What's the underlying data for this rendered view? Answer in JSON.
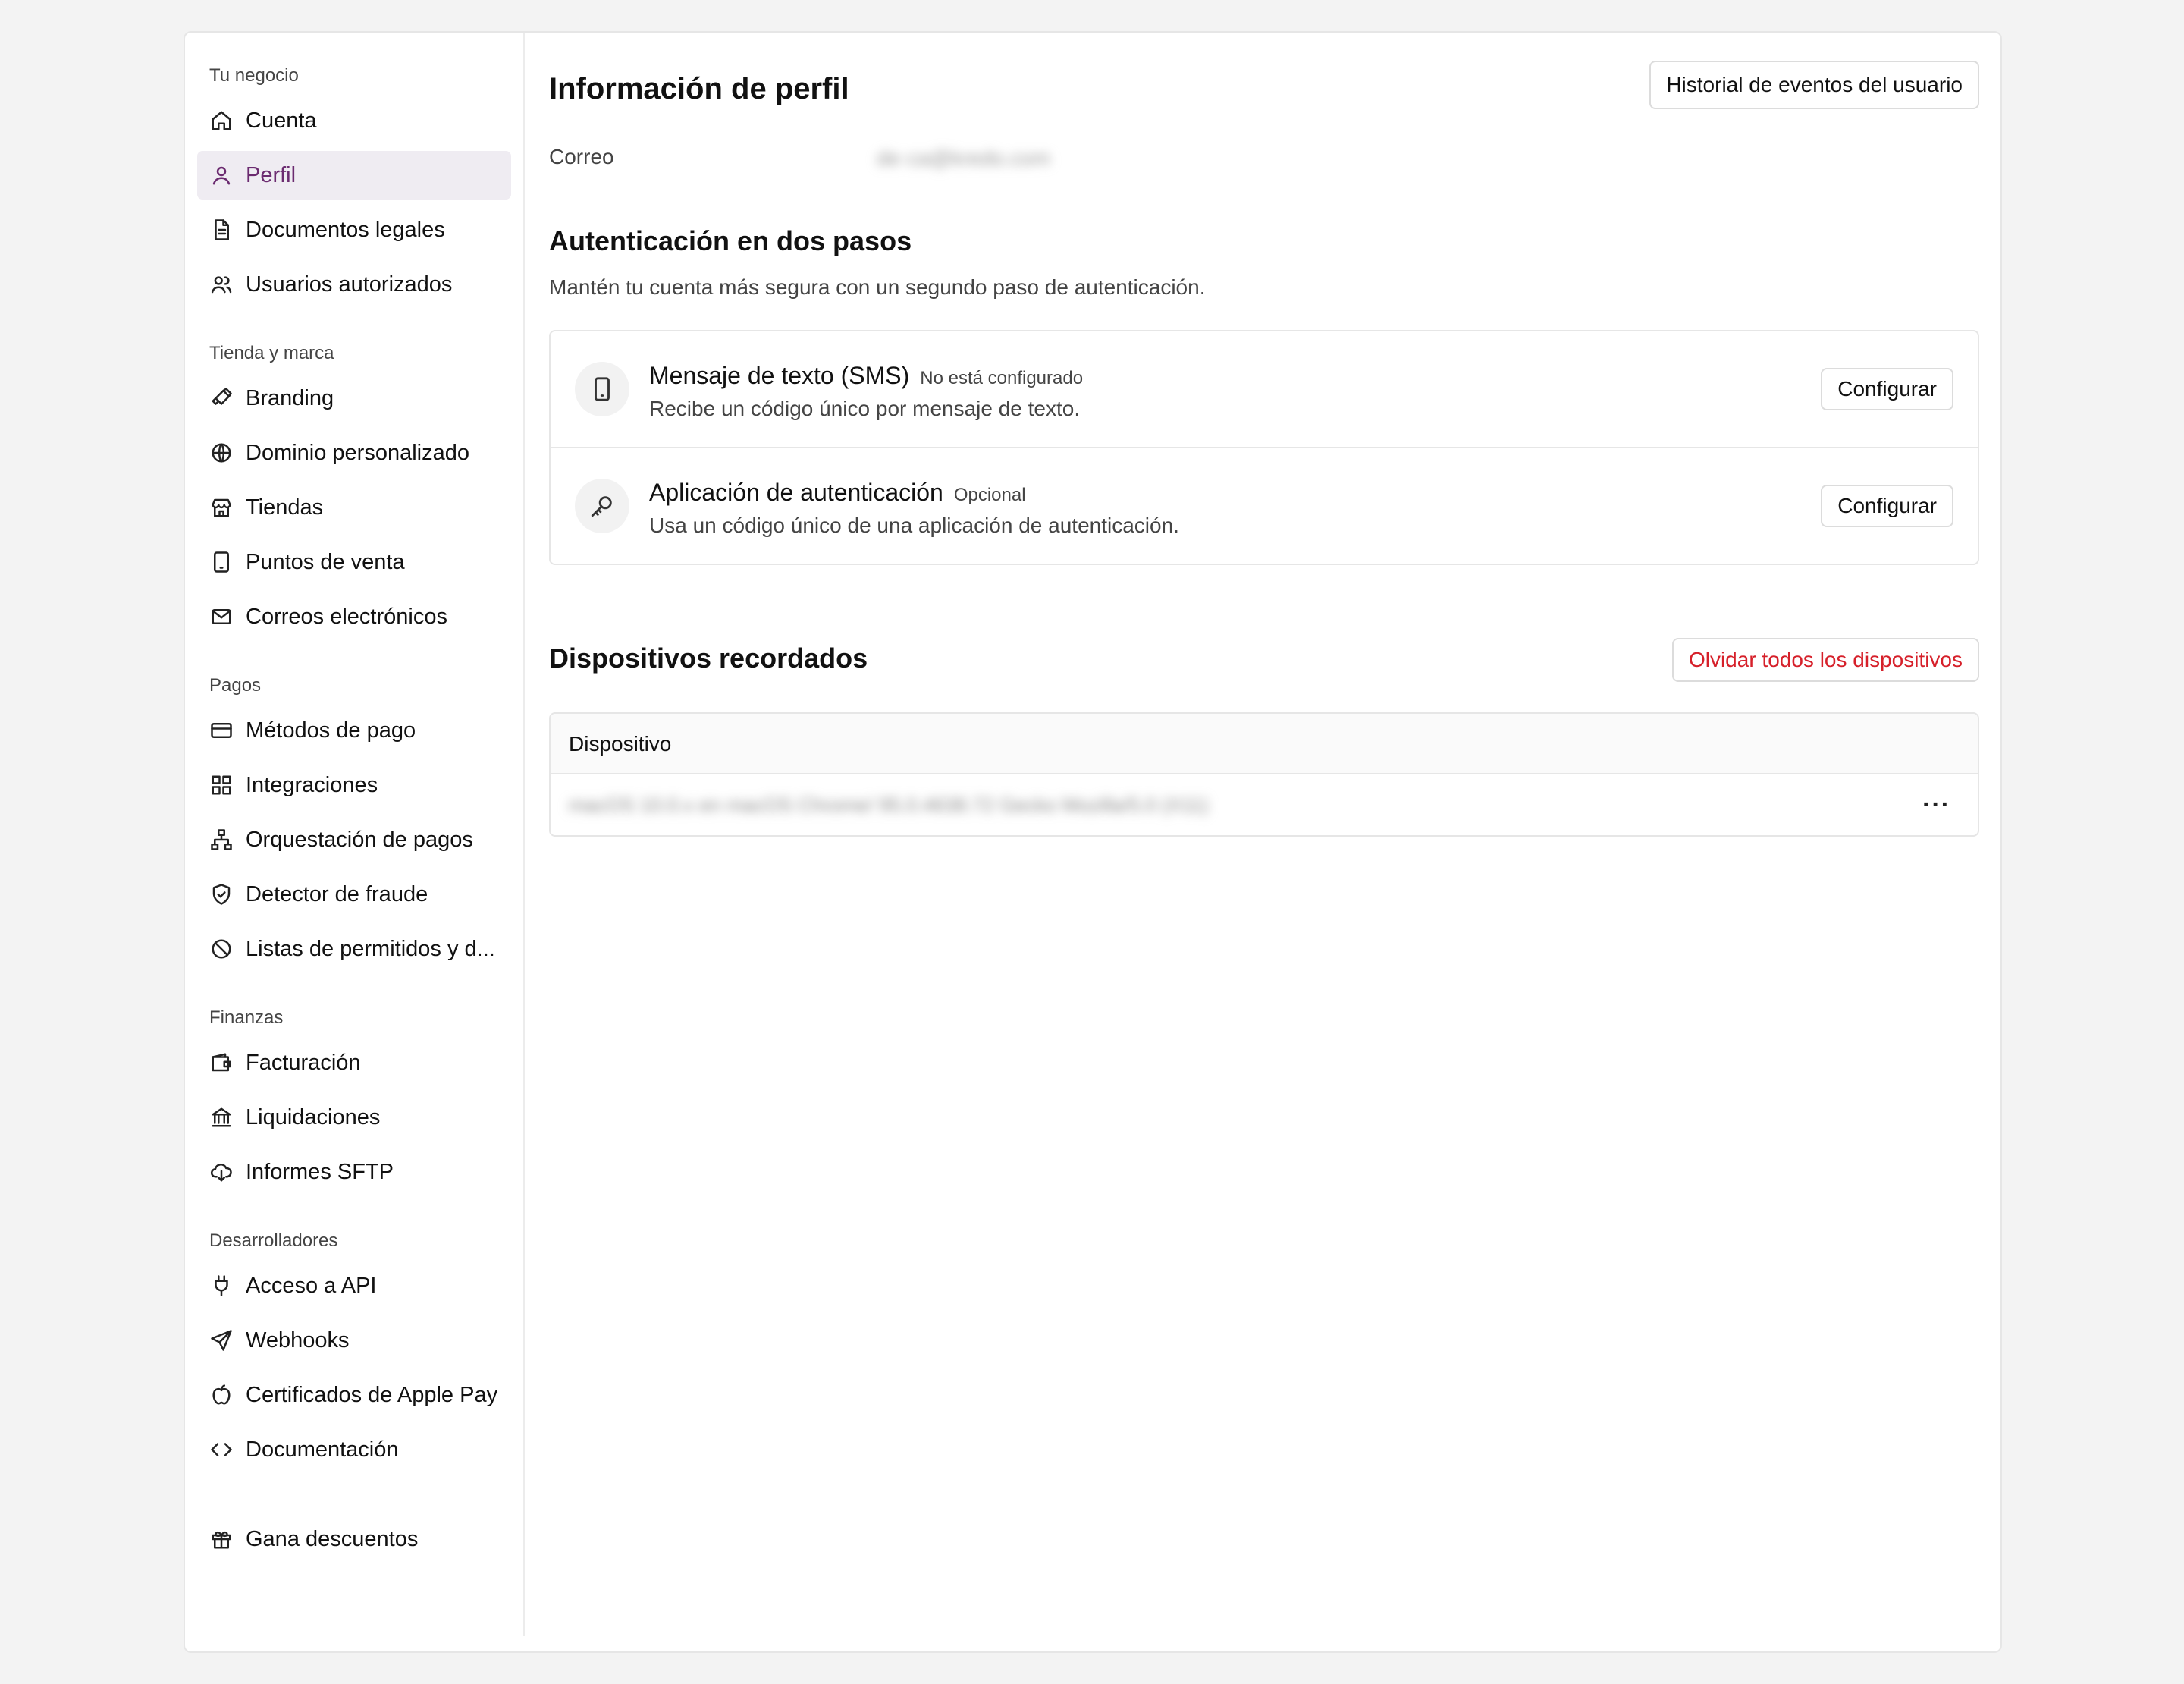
{
  "sidebar": {
    "sections": [
      {
        "heading": "Tu negocio",
        "items": [
          {
            "label": "Cuenta",
            "icon": "home-icon"
          },
          {
            "label": "Perfil",
            "icon": "user-icon",
            "active": true
          },
          {
            "label": "Documentos legales",
            "icon": "document-icon"
          },
          {
            "label": "Usuarios autorizados",
            "icon": "users-icon"
          }
        ]
      },
      {
        "heading": "Tienda y marca",
        "items": [
          {
            "label": "Branding",
            "icon": "brush-icon"
          },
          {
            "label": "Dominio personalizado",
            "icon": "globe-icon"
          },
          {
            "label": "Tiendas",
            "icon": "store-icon"
          },
          {
            "label": "Puntos de venta",
            "icon": "tablet-icon"
          },
          {
            "label": "Correos electrónicos",
            "icon": "mail-icon"
          }
        ]
      },
      {
        "heading": "Pagos",
        "items": [
          {
            "label": "Métodos de pago",
            "icon": "credit-card-icon"
          },
          {
            "label": "Integraciones",
            "icon": "grid-icon"
          },
          {
            "label": "Orquestación de pagos",
            "icon": "network-icon"
          },
          {
            "label": "Detector de fraude",
            "icon": "shield-check-icon"
          },
          {
            "label": "Listas de permitidos y d...",
            "icon": "ban-icon"
          }
        ]
      },
      {
        "heading": "Finanzas",
        "items": [
          {
            "label": "Facturación",
            "icon": "wallet-icon"
          },
          {
            "label": "Liquidaciones",
            "icon": "bank-icon"
          },
          {
            "label": "Informes SFTP",
            "icon": "cloud-download-icon"
          }
        ]
      },
      {
        "heading": "Desarrolladores",
        "items": [
          {
            "label": "Acceso a API",
            "icon": "plug-icon"
          },
          {
            "label": "Webhooks",
            "icon": "send-icon"
          },
          {
            "label": "Certificados de Apple Pay",
            "icon": "apple-icon"
          },
          {
            "label": "Documentación",
            "icon": "code-icon"
          }
        ]
      }
    ],
    "footer_item": {
      "label": "Gana descuentos",
      "icon": "gift-icon"
    }
  },
  "main": {
    "title": "Información de perfil",
    "history_button": "Historial de eventos del usuario",
    "email_label": "Correo",
    "email_value": "de·ca@kredo.com",
    "two_factor": {
      "title": "Autenticación en dos pasos",
      "description": "Mantén tu cuenta más segura con un segundo paso de autenticación.",
      "methods": [
        {
          "name": "Mensaje de texto (SMS)",
          "badge": "No está configurado",
          "description": "Recibe un código único por mensaje de texto.",
          "button": "Configurar",
          "icon": "phone-icon"
        },
        {
          "name": "Aplicación de autenticación",
          "badge": "Opcional",
          "description": "Usa un código único de una aplicación de autenticación.",
          "button": "Configurar",
          "icon": "key-icon"
        }
      ]
    },
    "devices": {
      "title": "Dispositivos recordados",
      "forget_button": "Olvidar todos los dispositivos",
      "column_header": "Dispositivo",
      "rows": [
        {
          "device": "macOS 10.0.x en macOS Chrome/ 95.0.4638.72 Gecko Mozilla/5.0 (X11)",
          "menu": "···"
        }
      ]
    }
  },
  "colors": {
    "accent": "#6b2b70",
    "active_bg": "#efecf2",
    "danger": "#d6202a"
  }
}
